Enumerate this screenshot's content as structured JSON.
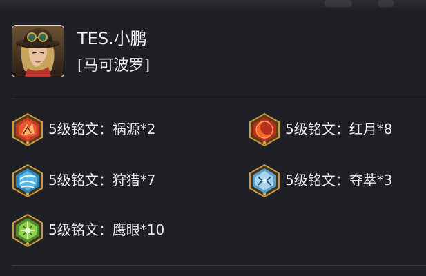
{
  "player": {
    "name": "TES.小鹏",
    "hero": "[马可波罗]"
  },
  "runes": [
    {
      "label": "5级铭文：祸源*2",
      "icon": "huoyuan-rune-icon",
      "color": "#d8442a"
    },
    {
      "label": "5级铭文：红月*8",
      "icon": "hongyue-rune-icon",
      "color": "#e0451f"
    },
    {
      "label": "5级铭文：狩猎*7",
      "icon": "shoulie-rune-icon",
      "color": "#4aa7cf"
    },
    {
      "label": "5级铭文：夺萃*3",
      "icon": "duocui-rune-icon",
      "color": "#7fb8d8"
    },
    {
      "label": "5级铭文：鹰眼*10",
      "icon": "yingyan-rune-icon",
      "color": "#7cc043"
    }
  ],
  "colors": {
    "background": "#1f2025",
    "divider": "#3d3e45",
    "text": "#ececec",
    "rune_frame_gold": "#c9983e"
  }
}
